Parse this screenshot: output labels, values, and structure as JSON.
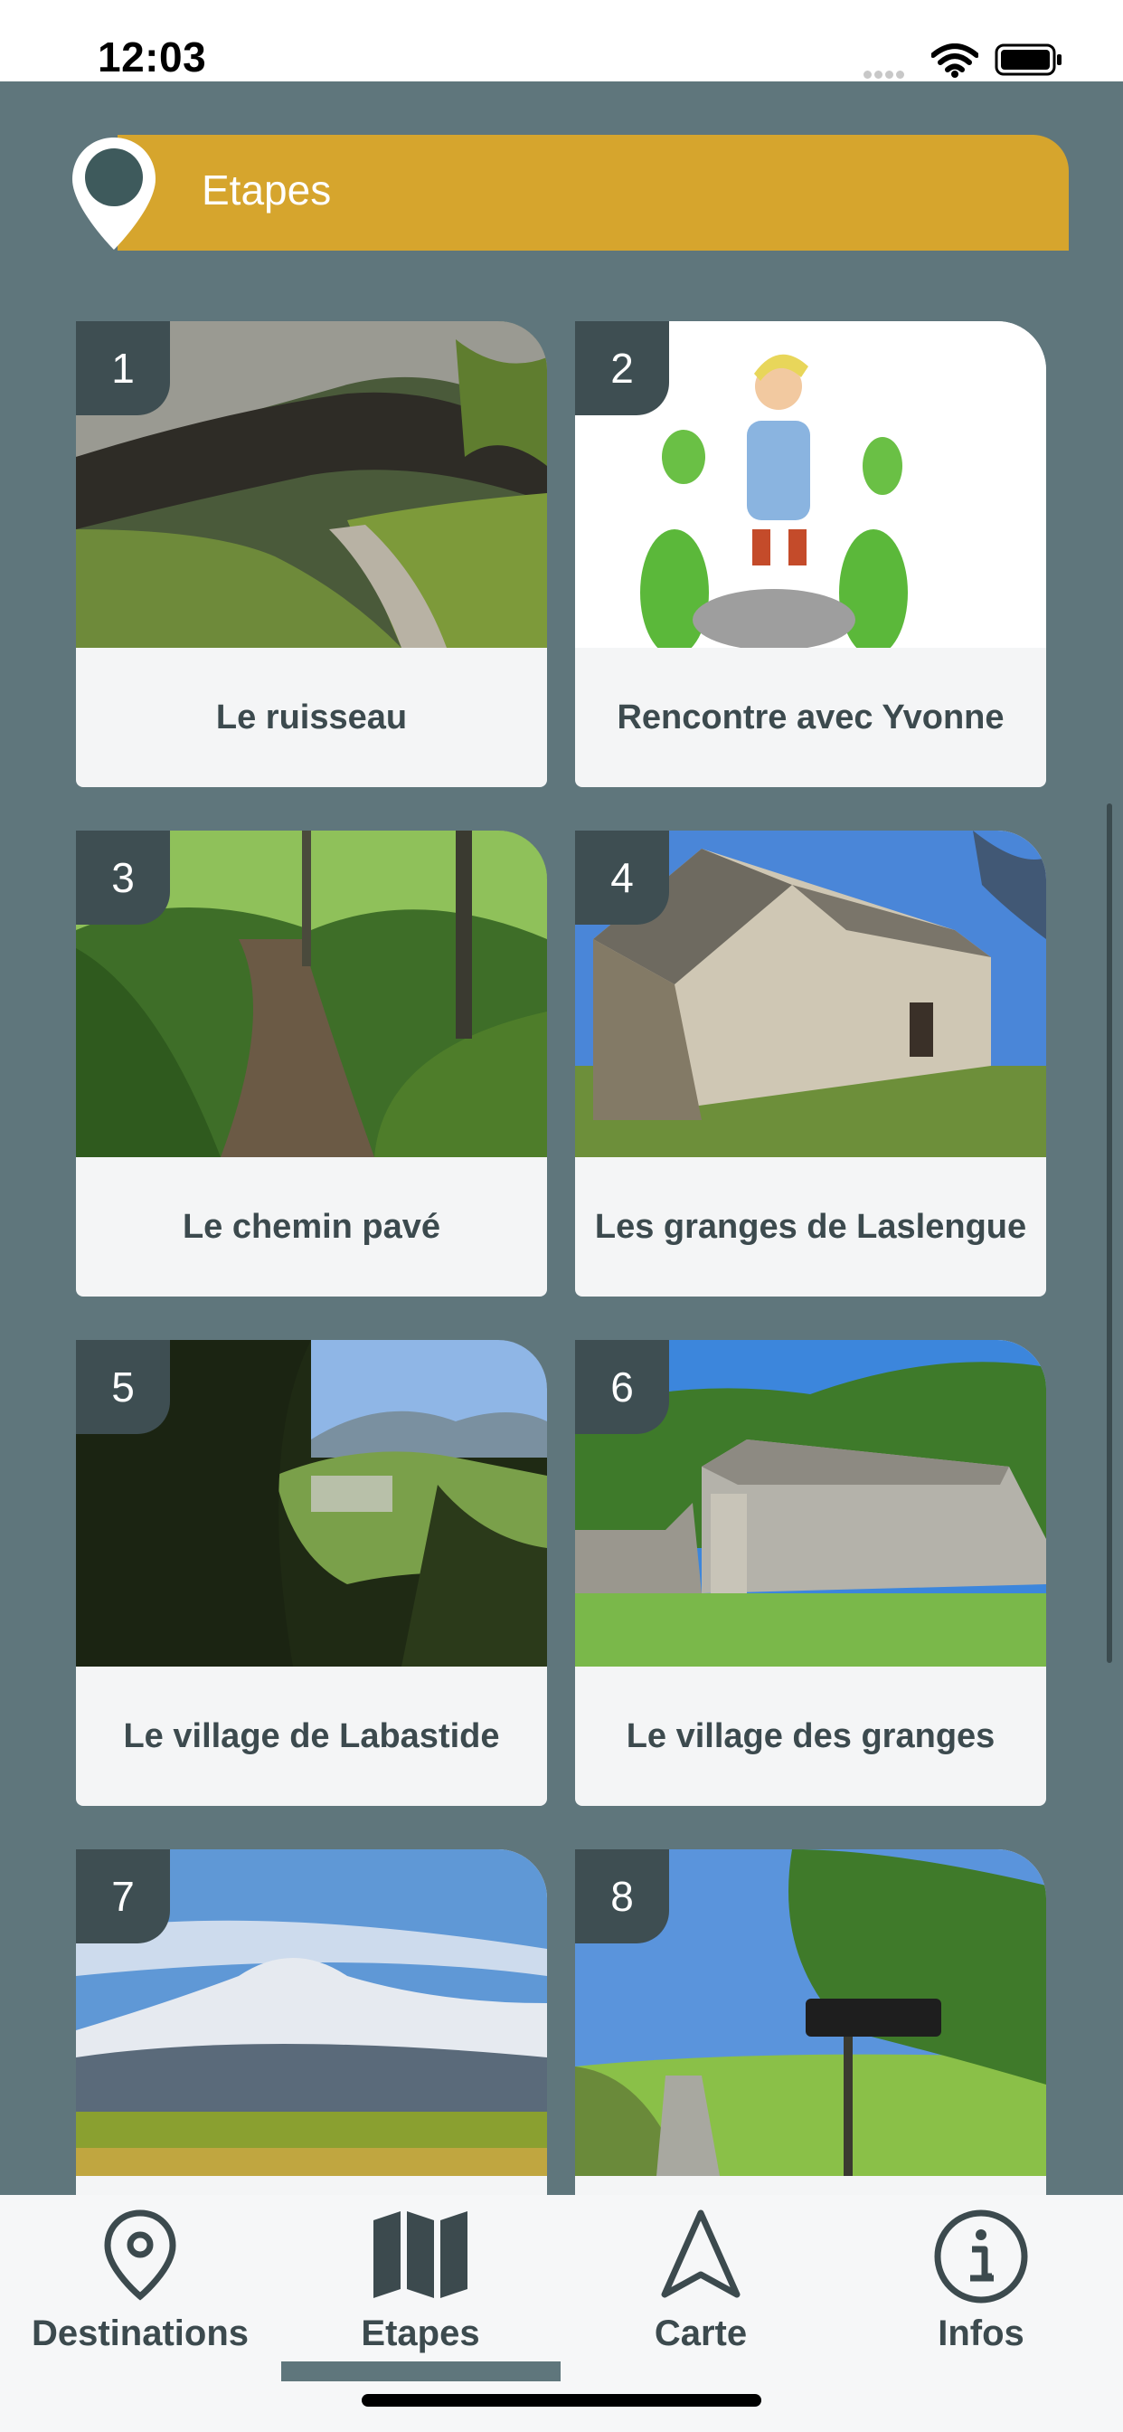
{
  "status": {
    "time": "12:03"
  },
  "header": {
    "title": "Etapes"
  },
  "steps": [
    {
      "number": "1",
      "label": "Le ruisseau"
    },
    {
      "number": "2",
      "label": "Rencontre avec Yvonne"
    },
    {
      "number": "3",
      "label": "Le chemin pavé"
    },
    {
      "number": "4",
      "label": "Les granges de Laslengue"
    },
    {
      "number": "5",
      "label": "Le village de Labastide"
    },
    {
      "number": "6",
      "label": "Le village des granges"
    },
    {
      "number": "7",
      "label": ""
    },
    {
      "number": "8",
      "label": ""
    }
  ],
  "tabs": [
    {
      "label": "Destinations",
      "icon": "location-pin-icon"
    },
    {
      "label": "Etapes",
      "icon": "map-icon",
      "active": true
    },
    {
      "label": "Carte",
      "icon": "navigation-arrow-icon"
    },
    {
      "label": "Infos",
      "icon": "info-icon"
    }
  ],
  "colors": {
    "background": "#5f767c",
    "banner": "#d6a52d",
    "badge": "#3e4e52",
    "text": "#3c4a4e"
  }
}
